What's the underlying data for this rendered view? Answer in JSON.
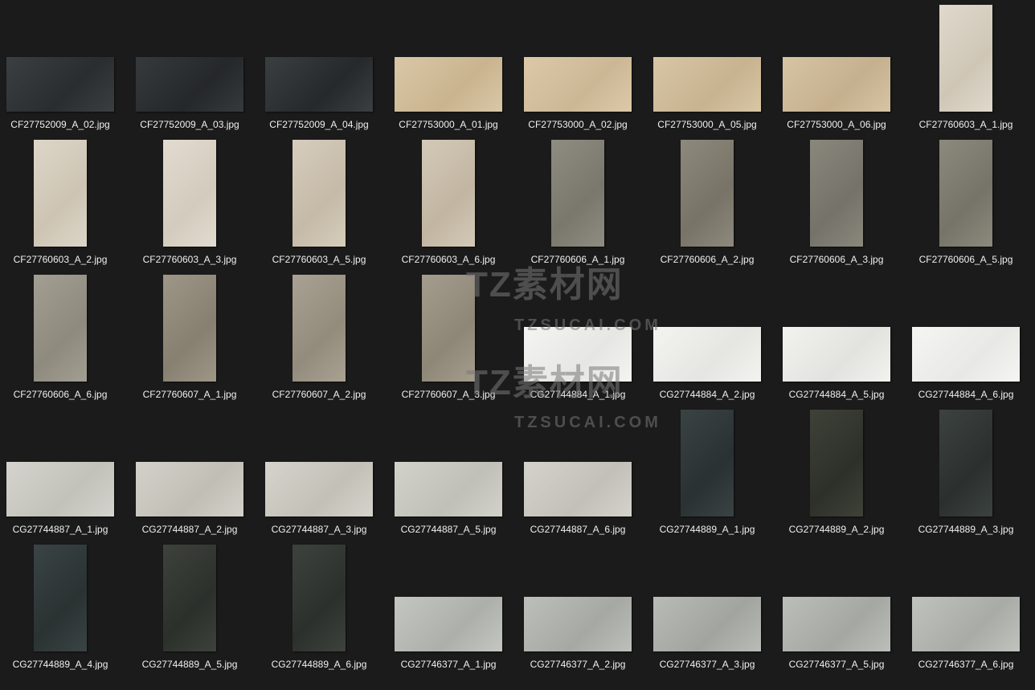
{
  "files": [
    {
      "name": "CF27752009_A_02.jpg",
      "orientation": "landscape",
      "color": "#3b3f41",
      "color2": "#2a2d2f"
    },
    {
      "name": "CF27752009_A_03.jpg",
      "orientation": "landscape",
      "color": "#363a3c",
      "color2": "#25282a"
    },
    {
      "name": "CF27752009_A_04.jpg",
      "orientation": "landscape",
      "color": "#3a3f42",
      "color2": "#26292b"
    },
    {
      "name": "CF27753000_A_01.jpg",
      "orientation": "landscape",
      "color": "#d9c7a6",
      "color2": "#c9b48f"
    },
    {
      "name": "CF27753000_A_02.jpg",
      "orientation": "landscape",
      "color": "#dcc9a8",
      "color2": "#ccb795"
    },
    {
      "name": "CF27753000_A_05.jpg",
      "orientation": "landscape",
      "color": "#d8c6a5",
      "color2": "#c8b390"
    },
    {
      "name": "CF27753000_A_06.jpg",
      "orientation": "landscape",
      "color": "#d6c4a3",
      "color2": "#c5b08e"
    },
    {
      "name": "CF27760603_A_1.jpg",
      "orientation": "portrait",
      "color": "#e0d9cc",
      "color2": "#cfc6b6"
    },
    {
      "name": "CF27760603_A_2.jpg",
      "orientation": "portrait",
      "color": "#ddd6c8",
      "color2": "#cdc4b3"
    },
    {
      "name": "CF27760603_A_3.jpg",
      "orientation": "portrait",
      "color": "#e2dbcf",
      "color2": "#d3cbbd"
    },
    {
      "name": "CF27760603_A_5.jpg",
      "orientation": "portrait",
      "color": "#d6cdbd",
      "color2": "#c5baa7"
    },
    {
      "name": "CF27760603_A_6.jpg",
      "orientation": "portrait",
      "color": "#d3c9b8",
      "color2": "#c2b6a2"
    },
    {
      "name": "CF27760606_A_1.jpg",
      "orientation": "portrait",
      "color": "#8f8c82",
      "color2": "#7a776d"
    },
    {
      "name": "CF27760606_A_2.jpg",
      "orientation": "portrait",
      "color": "#8d897c",
      "color2": "#777366"
    },
    {
      "name": "CF27760606_A_3.jpg",
      "orientation": "portrait",
      "color": "#8a877c",
      "color2": "#75726a"
    },
    {
      "name": "CF27760606_A_5.jpg",
      "orientation": "portrait",
      "color": "#8c897d",
      "color2": "#767368"
    },
    {
      "name": "CF27760606_A_6.jpg",
      "orientation": "portrait",
      "color": "#a29e92",
      "color2": "#8e8a7e"
    },
    {
      "name": "CF27760607_A_1.jpg",
      "orientation": "portrait",
      "color": "#9e9686",
      "color2": "#877f70"
    },
    {
      "name": "CF27760607_A_2.jpg",
      "orientation": "portrait",
      "color": "#a9a192",
      "color2": "#938b7c"
    },
    {
      "name": "CF27760607_A_3.jpg",
      "orientation": "portrait",
      "color": "#a49c8c",
      "color2": "#8e8676"
    },
    {
      "name": "CG27744884_A_1.jpg",
      "orientation": "landscape",
      "color": "#f4f4f2",
      "color2": "#e6e6e3"
    },
    {
      "name": "CG27744884_A_2.jpg",
      "orientation": "landscape",
      "color": "#f3f3f0",
      "color2": "#e5e5e1"
    },
    {
      "name": "CG27744884_A_5.jpg",
      "orientation": "landscape",
      "color": "#f2f2ef",
      "color2": "#e2e2de"
    },
    {
      "name": "CG27744884_A_6.jpg",
      "orientation": "landscape",
      "color": "#f5f5f3",
      "color2": "#e8e8e5"
    },
    {
      "name": "CG27744887_A_1.jpg",
      "orientation": "landscape",
      "color": "#d4d3cd",
      "color2": "#c2c1ba"
    },
    {
      "name": "CG27744887_A_2.jpg",
      "orientation": "landscape",
      "color": "#d3d1c9",
      "color2": "#c1beb5"
    },
    {
      "name": "CG27744887_A_3.jpg",
      "orientation": "landscape",
      "color": "#d5d3cb",
      "color2": "#c3c0b7"
    },
    {
      "name": "CG27744887_A_5.jpg",
      "orientation": "landscape",
      "color": "#d2d2cb",
      "color2": "#c0c0b8"
    },
    {
      "name": "CG27744887_A_6.jpg",
      "orientation": "landscape",
      "color": "#d4d3cb",
      "color2": "#c2c0b8"
    },
    {
      "name": "CG27744889_A_1.jpg",
      "orientation": "portrait",
      "color": "#3a4344",
      "color2": "#2a3132"
    },
    {
      "name": "CG27744889_A_2.jpg",
      "orientation": "portrait",
      "color": "#3f4239",
      "color2": "#2d3029"
    },
    {
      "name": "CG27744889_A_3.jpg",
      "orientation": "portrait",
      "color": "#3c4240",
      "color2": "#2b302e"
    },
    {
      "name": "CG27744889_A_4.jpg",
      "orientation": "portrait",
      "color": "#3b4444",
      "color2": "#2a3232"
    },
    {
      "name": "CG27744889_A_5.jpg",
      "orientation": "portrait",
      "color": "#3e423c",
      "color2": "#2c302b"
    },
    {
      "name": "CG27744889_A_6.jpg",
      "orientation": "portrait",
      "color": "#3d423d",
      "color2": "#2b302c"
    },
    {
      "name": "CG27746377_A_1.jpg",
      "orientation": "landscape",
      "color": "#c4c6c2",
      "color2": "#adafab"
    },
    {
      "name": "CG27746377_A_2.jpg",
      "orientation": "landscape",
      "color": "#bdbfbb",
      "color2": "#a6a8a4"
    },
    {
      "name": "CG27746377_A_3.jpg",
      "orientation": "landscape",
      "color": "#b9bbb7",
      "color2": "#a2a4a0"
    },
    {
      "name": "CG27746377_A_5.jpg",
      "orientation": "landscape",
      "color": "#bcbeba",
      "color2": "#a5a7a3"
    },
    {
      "name": "CG27746377_A_6.jpg",
      "orientation": "landscape",
      "color": "#c0c2be",
      "color2": "#a9aba7"
    }
  ],
  "watermark": {
    "cn": "TZ素材网",
    "en": "TZSUCAI.COM"
  }
}
